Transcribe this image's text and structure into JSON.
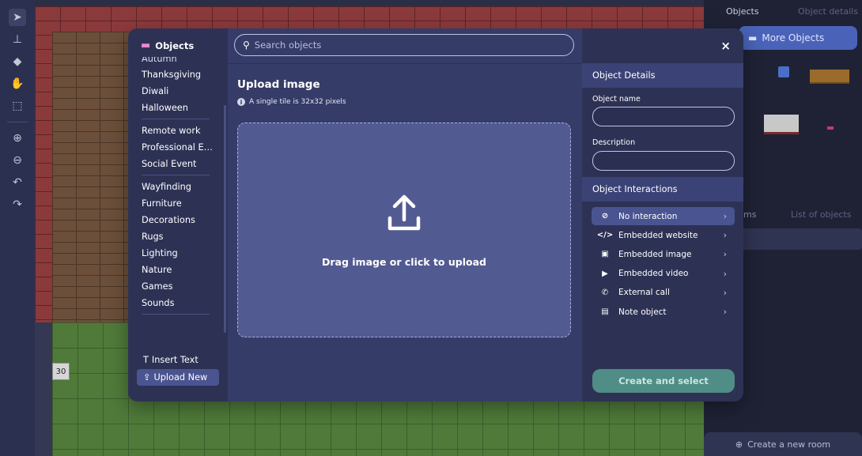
{
  "toolbar": {
    "tools": [
      {
        "icon": "pointer-icon",
        "glyph": "➤"
      },
      {
        "icon": "stamp-icon",
        "glyph": "⊥"
      },
      {
        "icon": "eraser-icon",
        "glyph": "◆"
      },
      {
        "icon": "hand-icon",
        "glyph": "✋"
      },
      {
        "icon": "select-area-icon",
        "glyph": "⬚"
      },
      {
        "icon": "zoom-in-icon",
        "glyph": "⊕"
      },
      {
        "icon": "zoom-out-icon",
        "glyph": "⊖"
      },
      {
        "icon": "undo-icon",
        "glyph": "↶"
      },
      {
        "icon": "redo-icon",
        "glyph": "↷"
      }
    ]
  },
  "map": {
    "tile_label": "30"
  },
  "right_panel": {
    "tab_objects": "Objects",
    "tab_object_details": "Object details",
    "more_objects": "More Objects",
    "tab_rooms": "ms",
    "tab_list": "List of objects",
    "create_room": "Create a new room"
  },
  "modal": {
    "sidebar": {
      "title": "Objects",
      "cut_item": "Autumn",
      "groups": [
        [
          "Thanksgiving",
          "Diwali",
          "Halloween"
        ],
        [
          "Remote work",
          "Professional Ev...",
          "Social Event"
        ],
        [
          "Wayfinding",
          "Furniture",
          "Decorations",
          "Rugs",
          "Lighting",
          "Nature",
          "Games",
          "Sounds"
        ]
      ],
      "insert_text": "Insert Text",
      "upload_new": "Upload New"
    },
    "search": {
      "placeholder": "Search objects"
    },
    "upload": {
      "title": "Upload image",
      "hint": "A single tile is 32x32 pixels",
      "dropzone_text": "Drag image or click to upload"
    },
    "details": {
      "close": "×",
      "section_details": "Object Details",
      "name_label": "Object name",
      "name_value": "",
      "description_label": "Description",
      "description_value": "",
      "section_interactions": "Object Interactions",
      "interactions": [
        {
          "label": "No interaction",
          "icon": "no-interaction-icon",
          "selected": true
        },
        {
          "label": "Embedded website",
          "icon": "code-icon",
          "selected": false
        },
        {
          "label": "Embedded image",
          "icon": "image-icon",
          "selected": false
        },
        {
          "label": "Embedded video",
          "icon": "play-icon",
          "selected": false
        },
        {
          "label": "External call",
          "icon": "phone-icon",
          "selected": false
        },
        {
          "label": "Note object",
          "icon": "note-icon",
          "selected": false
        }
      ],
      "create_button": "Create and select"
    }
  },
  "colors": {
    "accent": "#4a63b8",
    "modal_bg": "#343a63",
    "create_button": "#4f8d86"
  }
}
